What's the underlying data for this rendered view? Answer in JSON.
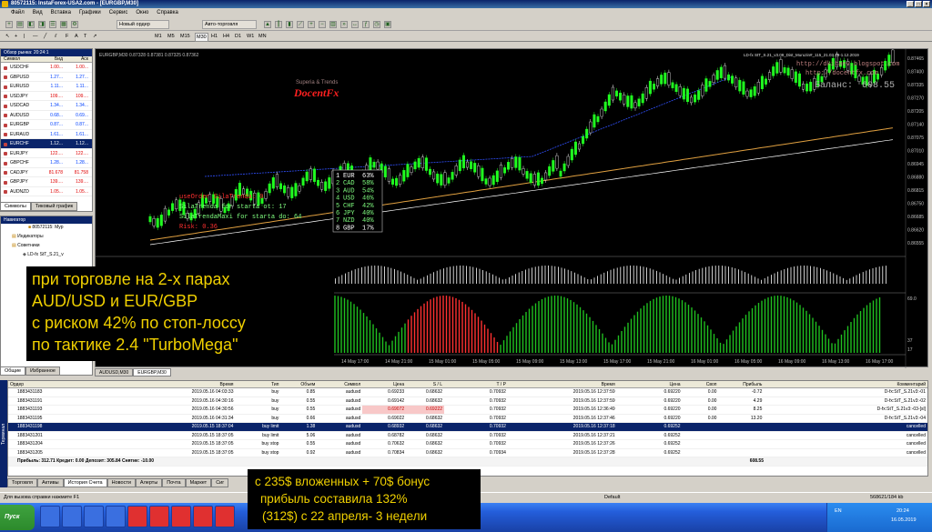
{
  "window": {
    "title": "80572115: InstaForex-USA2.com - [EURGBP,M30]"
  },
  "menu": [
    "Файл",
    "Вид",
    "Вставка",
    "Графики",
    "Сервис",
    "Окно",
    "Справка"
  ],
  "toolbar": {
    "new_order": "Новый ордер",
    "autotrading": "Авто-торговля",
    "timeframes": [
      "M1",
      "M5",
      "M15",
      "M30",
      "H1",
      "H4",
      "D1",
      "W1",
      "MN"
    ]
  },
  "market_watch": {
    "header": "Обзор рынка: 20:24:1",
    "cols": [
      "Символ",
      "Бид",
      "Аск"
    ],
    "rows": [
      {
        "sym": "USDCHF",
        "bid": "1.00...",
        "ask": "1.00...",
        "c": "red"
      },
      {
        "sym": "GBPUSD",
        "bid": "1.27...",
        "ask": "1.27...",
        "c": "blue"
      },
      {
        "sym": "EURUSD",
        "bid": "1.11...",
        "ask": "1.11...",
        "c": "blue"
      },
      {
        "sym": "USDJPY",
        "bid": "109....",
        "ask": "109....",
        "c": "red"
      },
      {
        "sym": "USDCAD",
        "bid": "1.34...",
        "ask": "1.34...",
        "c": "blue"
      },
      {
        "sym": "AUDUSD",
        "bid": "0.68...",
        "ask": "0.69...",
        "c": "blue"
      },
      {
        "sym": "EURGBP",
        "bid": "0.87...",
        "ask": "0.87...",
        "c": "blue"
      },
      {
        "sym": "EURAUD",
        "bid": "1.61...",
        "ask": "1.61...",
        "c": "blue"
      },
      {
        "sym": "EURCHF",
        "bid": "1.12...",
        "ask": "1.12...",
        "c": "sel"
      },
      {
        "sym": "EURJPY",
        "bid": "122....",
        "ask": "122....",
        "c": "red"
      },
      {
        "sym": "GBPCHF",
        "bid": "1.28...",
        "ask": "1.28...",
        "c": "blue"
      },
      {
        "sym": "CADJPY",
        "bid": "81.678",
        "ask": "81.758",
        "c": "red"
      },
      {
        "sym": "GBPJPY",
        "bid": "139....",
        "ask": "139....",
        "c": "red"
      },
      {
        "sym": "AUDNZD",
        "bid": "1.05...",
        "ask": "1.05...",
        "c": "red"
      }
    ],
    "tabs": [
      "Символы",
      "Тиковый график"
    ]
  },
  "navigator": {
    "header": "Навигатор",
    "items": [
      "80572115: Myp",
      "Индикаторы",
      "Советники",
      "LD-fx StT_S.21_v"
    ],
    "tabs": [
      "Общие",
      "Избранное"
    ]
  },
  "chart": {
    "header": "EURGBP,M30  0.87328 0.87381 0.87325 0.87362",
    "ea_label": "LD-fx StT_S.21_v3.09_Dist_Muruzin#_115_21.03.19-1.12.2019",
    "links": [
      "http://dkitaev.blogspot.com",
      "http://docentfx.com"
    ],
    "balance_label": "Баланс:",
    "balance_value": "608.55",
    "brand": "DocentFx",
    "brand_sub": "Superia & Trends",
    "info_lines": [
      "useOrder SilaTrenda: 0",
      "SilaTrenda for starta ot: 17",
      "SilaTrendaMaxi for starta do: 64",
      "Risk: 0.36"
    ],
    "strength": [
      {
        "n": "1",
        "c": "EUR",
        "v": "63%"
      },
      {
        "n": "2",
        "c": "CAD",
        "v": "58%"
      },
      {
        "n": "3",
        "c": "AUD",
        "v": "54%"
      },
      {
        "n": "4",
        "c": "USD",
        "v": "46%"
      },
      {
        "n": "5",
        "c": "CHF",
        "v": "42%"
      },
      {
        "n": "6",
        "c": "JPY",
        "v": "40%"
      },
      {
        "n": "7",
        "c": "NZD",
        "v": "40%"
      },
      {
        "n": "8",
        "c": "GBP",
        "v": "17%"
      }
    ],
    "prices": [
      "0.87465",
      "0.87400",
      "0.87335",
      "0.87270",
      "0.87205",
      "0.87140",
      "0.87075",
      "0.87010",
      "0.86945",
      "0.86880",
      "0.86815",
      "0.86750",
      "0.86685",
      "0.86620",
      "0.86555"
    ],
    "sub_ticks": [
      "69.0",
      "37",
      "17"
    ],
    "time_ticks": [
      "14 May 17:00",
      "14 May 21:00",
      "15 May 01:00",
      "15 May 05:00",
      "15 May 09:00",
      "15 May 13:00",
      "15 May 17:00",
      "15 May 21:00",
      "16 May 01:00",
      "16 May 05:00",
      "16 May 09:00",
      "16 May 13:00",
      "16 May 17:00"
    ],
    "tabs": [
      "AUDUSD,M30",
      "EURGBP,M30"
    ]
  },
  "overlay_top": [
    "при торговле на 2-х парах",
    "AUD/USD и EUR/GBP",
    "с риском 42% по стоп-лоссу",
    "по тактике 2.4 \"TurboMega\""
  ],
  "overlay_bottom": [
    "с 235$ вложенных + 70$ бонус",
    "прибыль составила 132%",
    "(312$)  с 22 апреля- 3 недели"
  ],
  "orders": {
    "cols": [
      "Ордер",
      "Время",
      "Тип",
      "Объем",
      "Символ",
      "Цена",
      "S / L",
      "T / P",
      "Время",
      "Цена",
      "Своп",
      "Прибыль",
      "Комментарий"
    ],
    "rows": [
      [
        "1883431183",
        "2019.05.16 04:03:33",
        "buy",
        "0.85",
        "audusd",
        "0.69233",
        "0.68632",
        "0.70932",
        "2019.05.16 12:37:59",
        "0.69220",
        "0.00",
        "-0.72",
        "D-fx:StT_S.21v3:-01"
      ],
      [
        "1883431191",
        "2019.05.16 04:30:16",
        "buy",
        "0.55",
        "audusd",
        "0.69142",
        "0.68632",
        "0.70932",
        "2019.05.16 12:37:59",
        "0.69220",
        "0.00",
        "4.29",
        "D-fx:StT_S.21v3:-02"
      ],
      [
        "1883431193",
        "2019.05.16 04:30:56",
        "buy",
        "0.55",
        "audusd",
        "0.69072",
        "0.69222",
        "0.70932",
        "2019.05.16 12:36:49",
        "0.69220",
        "0.00",
        "8.25",
        "D-fx:StT_S.21v3:-03-[sl]"
      ],
      [
        "1883431195",
        "2019.05.16 04:31:34",
        "buy",
        "0.66",
        "audusd",
        "0.69022",
        "0.68632",
        "0.70932",
        "2019.05.16 12:37:46",
        "0.69220",
        "0.00",
        "13.20",
        "D-fx:StT_S.21v3:-04"
      ],
      [
        "1883431198",
        "2019.05.15 18:37:04",
        "buy limit",
        "1.38",
        "audusd",
        "0.68932",
        "0.68632",
        "0.70932",
        "2019.05.16 12:37:18",
        "0.69252",
        "",
        "",
        "cancelled"
      ],
      [
        "1883431201",
        "2019.05.15 18:37:05",
        "buy limit",
        "5.06",
        "audusd",
        "0.68782",
        "0.68632",
        "0.70932",
        "2019.05.16 12:37:21",
        "0.69252",
        "",
        "",
        "cancelled"
      ],
      [
        "1883431204",
        "2019.05.15 18:37:05",
        "buy stop",
        "0.55",
        "audusd",
        "0.70632",
        "0.68632",
        "0.70932",
        "2019.05.16 12:37:26",
        "0.69252",
        "",
        "",
        "cancelled"
      ],
      [
        "1883431205",
        "2019.05.15 18:37:05",
        "buy stop",
        "0.92",
        "audusd",
        "0.70834",
        "0.68632",
        "0.70934",
        "2019.05.16 12:37:28",
        "0.69252",
        "",
        "",
        "cancelled"
      ]
    ],
    "total": "Прибыль: 312.71  Кредит: 0.00  Депозит: 305.84  Снятие: -10.00",
    "total_value": "608.55"
  },
  "side_label": "Терминал",
  "bottom_tabs": [
    "Торговля",
    "Активы",
    "История Счета",
    "Новости",
    "Алерты",
    "Почта",
    "Маркет",
    "Сиг"
  ],
  "status": {
    "help": "Для вызова справки нажмите F1",
    "profile": "Default",
    "conn": "568621/184 kb"
  },
  "taskbar": {
    "start": "Пуск",
    "lang": "EN",
    "time": "20:24",
    "date": "16.05.2019"
  }
}
